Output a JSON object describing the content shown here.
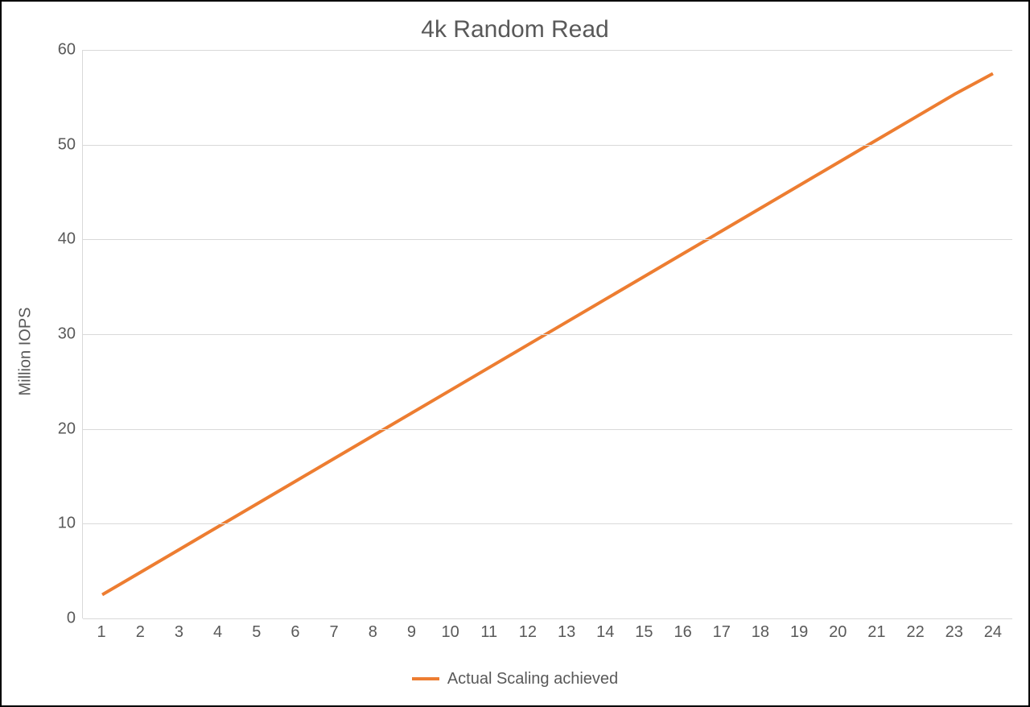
{
  "chart_data": {
    "type": "line",
    "title": "4k Random Read",
    "ylabel": "Million IOPS",
    "xlabel": "",
    "ylim": [
      0,
      60
    ],
    "yticks": [
      0,
      10,
      20,
      30,
      40,
      50,
      60
    ],
    "categories": [
      "1",
      "2",
      "3",
      "4",
      "5",
      "6",
      "7",
      "8",
      "9",
      "10",
      "11",
      "12",
      "13",
      "14",
      "15",
      "16",
      "17",
      "18",
      "19",
      "20",
      "21",
      "22",
      "23",
      "24"
    ],
    "series": [
      {
        "name": "Actual Scaling achieved",
        "color": "#ED7D31",
        "values": [
          2.5,
          4.9,
          7.3,
          9.7,
          12.1,
          14.5,
          16.9,
          19.3,
          21.7,
          24.1,
          26.5,
          28.9,
          31.3,
          33.7,
          36.1,
          38.5,
          40.9,
          43.3,
          45.7,
          48.1,
          50.5,
          52.9,
          55.3,
          57.5
        ]
      }
    ],
    "grid": true,
    "legend_position": "bottom"
  }
}
